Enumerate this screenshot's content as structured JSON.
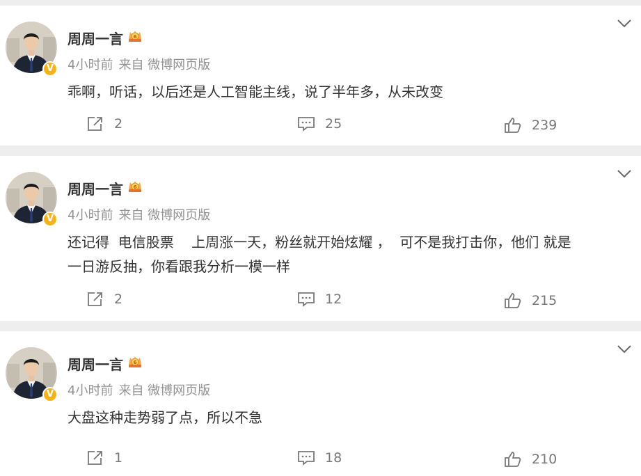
{
  "posts": [
    {
      "author": "周周一言",
      "time": "4小时前",
      "source": "来自 微博网页版",
      "text": "乖啊，听话，以后还是人工智能主线，说了半年多，从未改变",
      "reposts": "2",
      "comments": "25",
      "likes": "239"
    },
    {
      "author": "周周一言",
      "time": "4小时前",
      "source": "来自 微博网页版",
      "text": "还记得  电信股票    上周涨一天，粉丝就开始炫耀 ，  可不是我打击你，他们 就是\n一日游反抽，你看跟我分析一模一样",
      "reposts": "2",
      "comments": "12",
      "likes": "215"
    },
    {
      "author": "周周一言",
      "time": "4小时前",
      "source": "来自 微博网页版",
      "text": "大盘这种走势弱了点，所以不急",
      "reposts": "1",
      "comments": "18",
      "likes": "210"
    }
  ],
  "badge_letter": "V",
  "colors": {
    "accent": "#f2b41a",
    "meta": "#939393",
    "background": "#eeeeee"
  }
}
